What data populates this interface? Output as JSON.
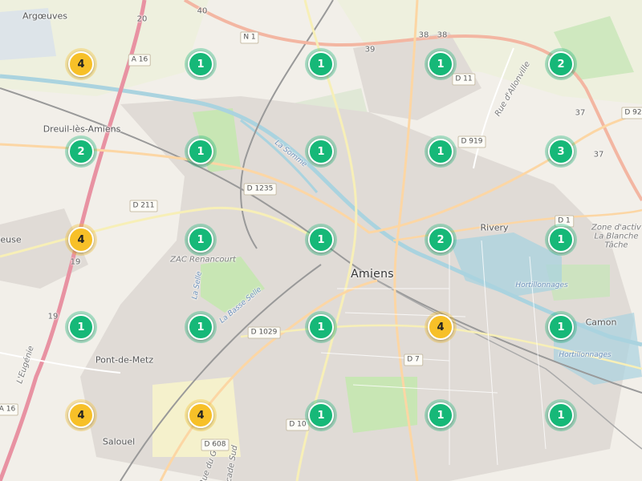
{
  "map": {
    "places": [
      {
        "id": "argoeuves",
        "label": "Argœuves",
        "cls": "small"
      },
      {
        "id": "dreuil",
        "label": "Dreuil-lès-Amiens",
        "cls": "small"
      },
      {
        "id": "amiens",
        "label": "Amiens",
        "cls": "city"
      },
      {
        "id": "rivery",
        "label": "Rivery",
        "cls": "small"
      },
      {
        "id": "camon",
        "label": "Camon",
        "cls": "small"
      },
      {
        "id": "pontdemetz",
        "label": "Pont-de-Metz",
        "cls": "small"
      },
      {
        "id": "salouel",
        "label": "Salouel",
        "cls": "small"
      },
      {
        "id": "leuse",
        "label": "leuse",
        "cls": "small"
      },
      {
        "id": "zac",
        "label": "ZAC Renancourt",
        "cls": "italic"
      },
      {
        "id": "zone",
        "label": "Zone d'activ La Blanche Tâche",
        "cls": "italic multi"
      },
      {
        "id": "hort1",
        "label": "Hortillonnages",
        "cls": "water"
      },
      {
        "id": "hort2",
        "label": "Hortillonnages",
        "cls": "water"
      },
      {
        "id": "somme",
        "label": "La Somme",
        "cls": "water"
      },
      {
        "id": "selle1",
        "label": "La Selle",
        "cls": "water"
      },
      {
        "id": "selle2",
        "label": "La Basse Selle",
        "cls": "water"
      },
      {
        "id": "allonville",
        "label": "Rue d'Allonville",
        "cls": "italic"
      },
      {
        "id": "eugenie",
        "label": "L'Eugénie",
        "cls": "italic"
      },
      {
        "id": "golf",
        "label": "Rue du Golf",
        "cls": "italic"
      },
      {
        "id": "rocsud",
        "label": "Rocade Sud",
        "cls": "italic"
      }
    ],
    "roads": [
      {
        "id": "a16_top",
        "label": "A 16"
      },
      {
        "id": "n1",
        "label": "N 1"
      },
      {
        "id": "d11",
        "label": "D 11"
      },
      {
        "id": "d919",
        "label": "D 919"
      },
      {
        "id": "d1235",
        "label": "D 1235"
      },
      {
        "id": "d211",
        "label": "D 211"
      },
      {
        "id": "d1",
        "label": "D 1"
      },
      {
        "id": "d92",
        "label": "D 92"
      },
      {
        "id": "d1029",
        "label": "D 1029"
      },
      {
        "id": "d7",
        "label": "D 7"
      },
      {
        "id": "d10",
        "label": "D 10"
      },
      {
        "id": "d608",
        "label": "D 608"
      },
      {
        "id": "a16_bot",
        "label": "A 16"
      }
    ],
    "route_numbers": [
      "20",
      "40",
      "38",
      "38",
      "39",
      "37",
      "37",
      "19",
      "19"
    ]
  },
  "clusters": [
    {
      "count": "4",
      "kind": "amber"
    },
    {
      "count": "1",
      "kind": "green"
    },
    {
      "count": "1",
      "kind": "green"
    },
    {
      "count": "1",
      "kind": "green"
    },
    {
      "count": "2",
      "kind": "green"
    },
    {
      "count": "2",
      "kind": "green"
    },
    {
      "count": "1",
      "kind": "green"
    },
    {
      "count": "1",
      "kind": "green"
    },
    {
      "count": "1",
      "kind": "green"
    },
    {
      "count": "3",
      "kind": "green"
    },
    {
      "count": "4",
      "kind": "amber"
    },
    {
      "count": "1",
      "kind": "green"
    },
    {
      "count": "1",
      "kind": "green"
    },
    {
      "count": "2",
      "kind": "green"
    },
    {
      "count": "1",
      "kind": "green"
    },
    {
      "count": "1",
      "kind": "green"
    },
    {
      "count": "1",
      "kind": "green"
    },
    {
      "count": "1",
      "kind": "green"
    },
    {
      "count": "4",
      "kind": "amber"
    },
    {
      "count": "1",
      "kind": "green"
    },
    {
      "count": "4",
      "kind": "amber"
    },
    {
      "count": "4",
      "kind": "amber"
    },
    {
      "count": "1",
      "kind": "green"
    },
    {
      "count": "1",
      "kind": "green"
    },
    {
      "count": "1",
      "kind": "green"
    }
  ],
  "colors": {
    "cluster_green": "#16b878",
    "cluster_amber": "#f7c028",
    "water": "#aad3df",
    "motorway": "#e892a2",
    "primary": "#fcd6a4"
  }
}
